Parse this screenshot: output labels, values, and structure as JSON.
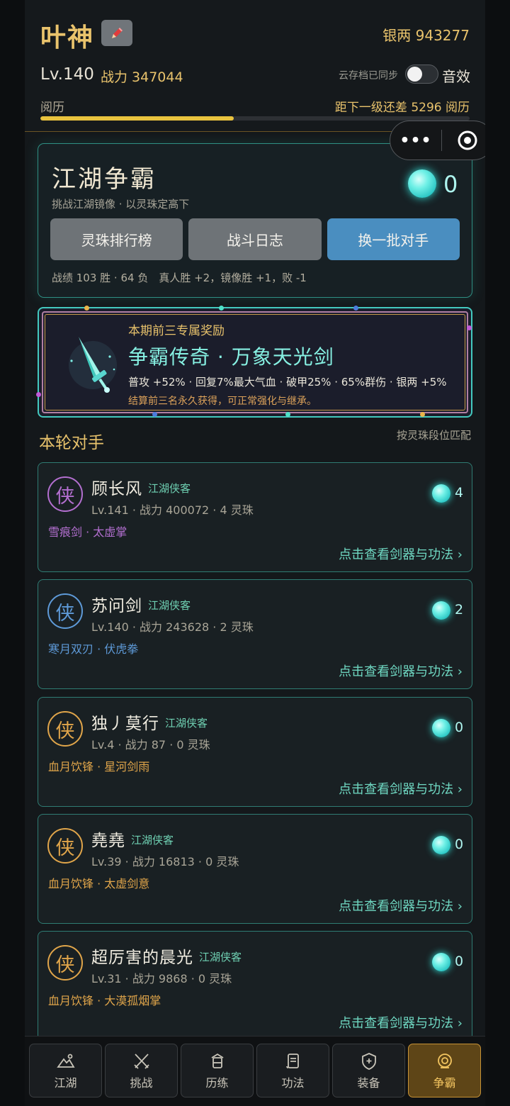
{
  "header": {
    "name": "叶神",
    "silver": "银两 943277",
    "level": "Lv.140",
    "power": "战力 347044",
    "cloud_sync": "云存档已同步",
    "sound_label": "音效",
    "sound_on": false,
    "exp_label": "阅历",
    "exp_remaining": "距下一级还差 5296 阅历",
    "exp_progress": 0.45
  },
  "capsule": {
    "more": "•••"
  },
  "arena": {
    "title": "江湖争霸",
    "subtitle": "挑战江湖镜像 · 以灵珠定高下",
    "pearls": "0",
    "buttons": [
      "灵珠排行榜",
      "战斗日志",
      "换一批对手"
    ],
    "record": "战绩 103 胜 · 64 负　真人胜 +2，镜像胜 +1，败 -1"
  },
  "reward": {
    "tag": "本期前三专属奖励",
    "title": "争霸传奇 · 万象天光剑",
    "stats": "普攻 +52% · 回复7%最大气血 · 破甲25% · 65%群伤 · 银两 +5%",
    "note": "结算前三名永久获得，可正常强化与继承。"
  },
  "opponents_section": {
    "title": "本轮对手",
    "hint": "按灵珠段位匹配"
  },
  "opponents": [
    {
      "avatar": "侠",
      "name": "顾长风",
      "tag": "江湖侠客",
      "meta": "Lv.141 · 战力 400072 · 4 灵珠",
      "skill": "雪痕剑 · 太虚掌",
      "pearls": "4",
      "view": "点击查看剑器与功法 ›",
      "color": "#b36fd0"
    },
    {
      "avatar": "侠",
      "name": "苏问剑",
      "tag": "江湖侠客",
      "meta": "Lv.140 · 战力 243628 · 2 灵珠",
      "skill": "寒月双刃 · 伏虎拳",
      "pearls": "2",
      "view": "点击查看剑器与功法 ›",
      "color": "#5e9ad8"
    },
    {
      "avatar": "侠",
      "name": "独丿莫行",
      "tag": "江湖侠客",
      "meta": "Lv.4 · 战力 87 · 0 灵珠",
      "skill": "血月饮锋 · 星河剑雨",
      "pearls": "0",
      "view": "点击查看剑器与功法 ›",
      "color": "#e0a54a"
    },
    {
      "avatar": "侠",
      "name": "堯堯",
      "tag": "江湖侠客",
      "meta": "Lv.39 · 战力 16813 · 0 灵珠",
      "skill": "血月饮锋 · 太虚剑意",
      "pearls": "0",
      "view": "点击查看剑器与功法 ›",
      "color": "#e0a54a"
    },
    {
      "avatar": "侠",
      "name": "超厉害的晨光",
      "tag": "江湖侠客",
      "meta": "Lv.31 · 战力 9868 · 0 灵珠",
      "skill": "血月饮锋 · 大漠孤烟掌",
      "pearls": "0",
      "view": "点击查看剑器与功法 ›",
      "color": "#e0a54a"
    }
  ],
  "tabs": [
    {
      "label": "江湖",
      "icon": "mountain-icon"
    },
    {
      "label": "挑战",
      "icon": "crossed-swords-icon"
    },
    {
      "label": "历练",
      "icon": "lantern-icon"
    },
    {
      "label": "功法",
      "icon": "scroll-icon"
    },
    {
      "label": "装备",
      "icon": "shield-icon"
    },
    {
      "label": "争霸",
      "icon": "target-icon",
      "active": true
    }
  ],
  "colors": {
    "gold": "#e9c36c",
    "teal": "#43c9bf",
    "primary_button": "#4a8ec0",
    "active_tab": "#5e4517"
  }
}
